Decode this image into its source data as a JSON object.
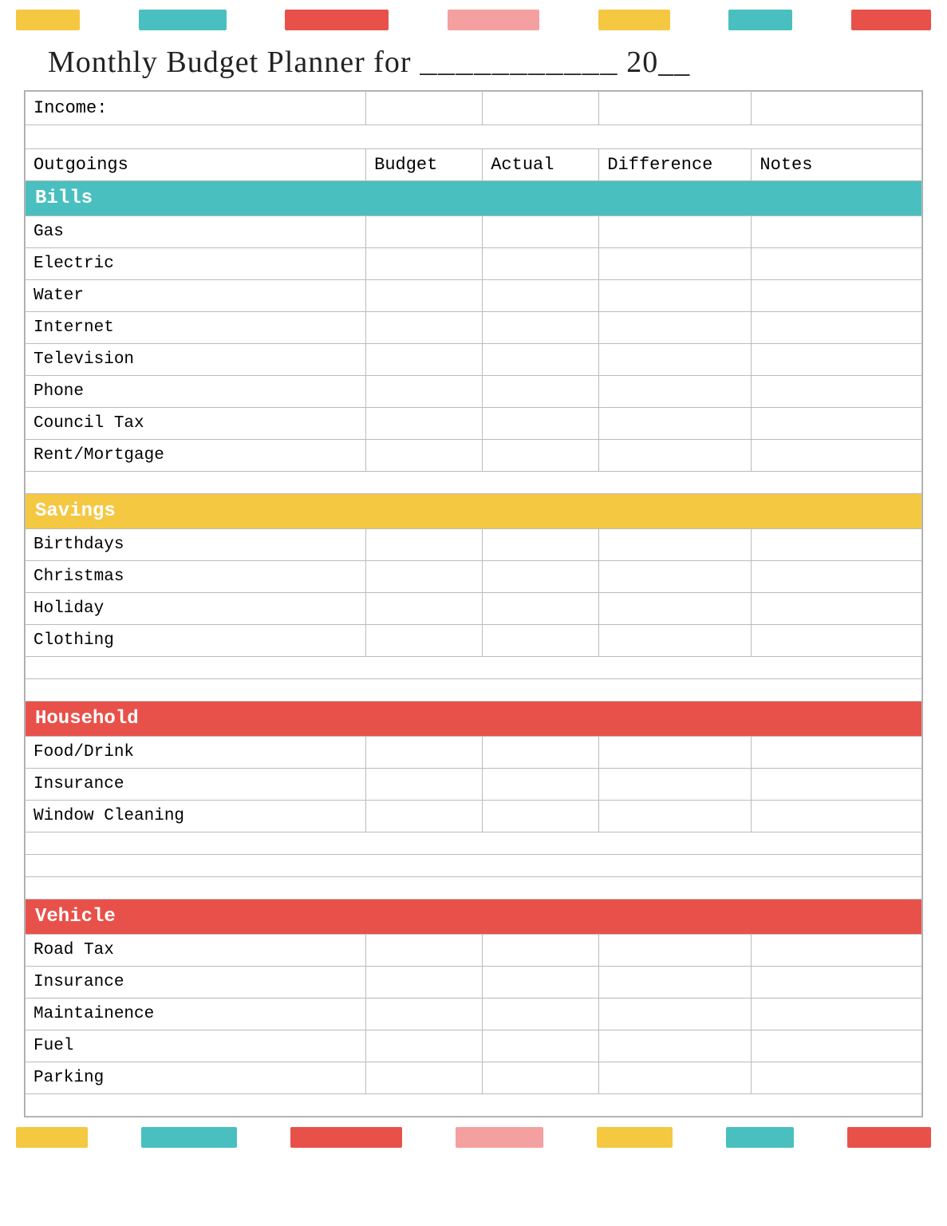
{
  "title": "Monthly Budget Planner for",
  "title_blank": "___________",
  "title_year": "20__",
  "columns": {
    "label": "Outgoings",
    "budget": "Budget",
    "actual": "Actual",
    "difference": "Difference",
    "notes": "Notes"
  },
  "income_label": "Income:",
  "sections": [
    {
      "name": "Bills",
      "color": "bills",
      "items": [
        "Gas",
        "Electric",
        "Water",
        "Internet",
        "Television",
        "Phone",
        "Council Tax",
        "Rent/Mortgage"
      ]
    },
    {
      "name": "Savings",
      "color": "savings",
      "items": [
        "Birthdays",
        "Christmas",
        "Holiday",
        "Clothing"
      ]
    },
    {
      "name": "Household",
      "color": "household",
      "items": [
        "Food/Drink",
        "Insurance",
        "Window Cleaning"
      ]
    },
    {
      "name": "Vehicle",
      "color": "vehicle",
      "items": [
        "Road Tax",
        "Insurance",
        "Maintainence",
        "Fuel",
        "Parking"
      ]
    }
  ],
  "top_bar_colors": [
    "yellow",
    "teal",
    "white",
    "red",
    "white",
    "pink",
    "white",
    "yellow",
    "white",
    "teal",
    "white",
    "red"
  ],
  "bottom_bar_colors": [
    "yellow",
    "white",
    "teal",
    "white",
    "red",
    "white",
    "pink",
    "white",
    "yellow",
    "white",
    "teal",
    "white",
    "red"
  ]
}
